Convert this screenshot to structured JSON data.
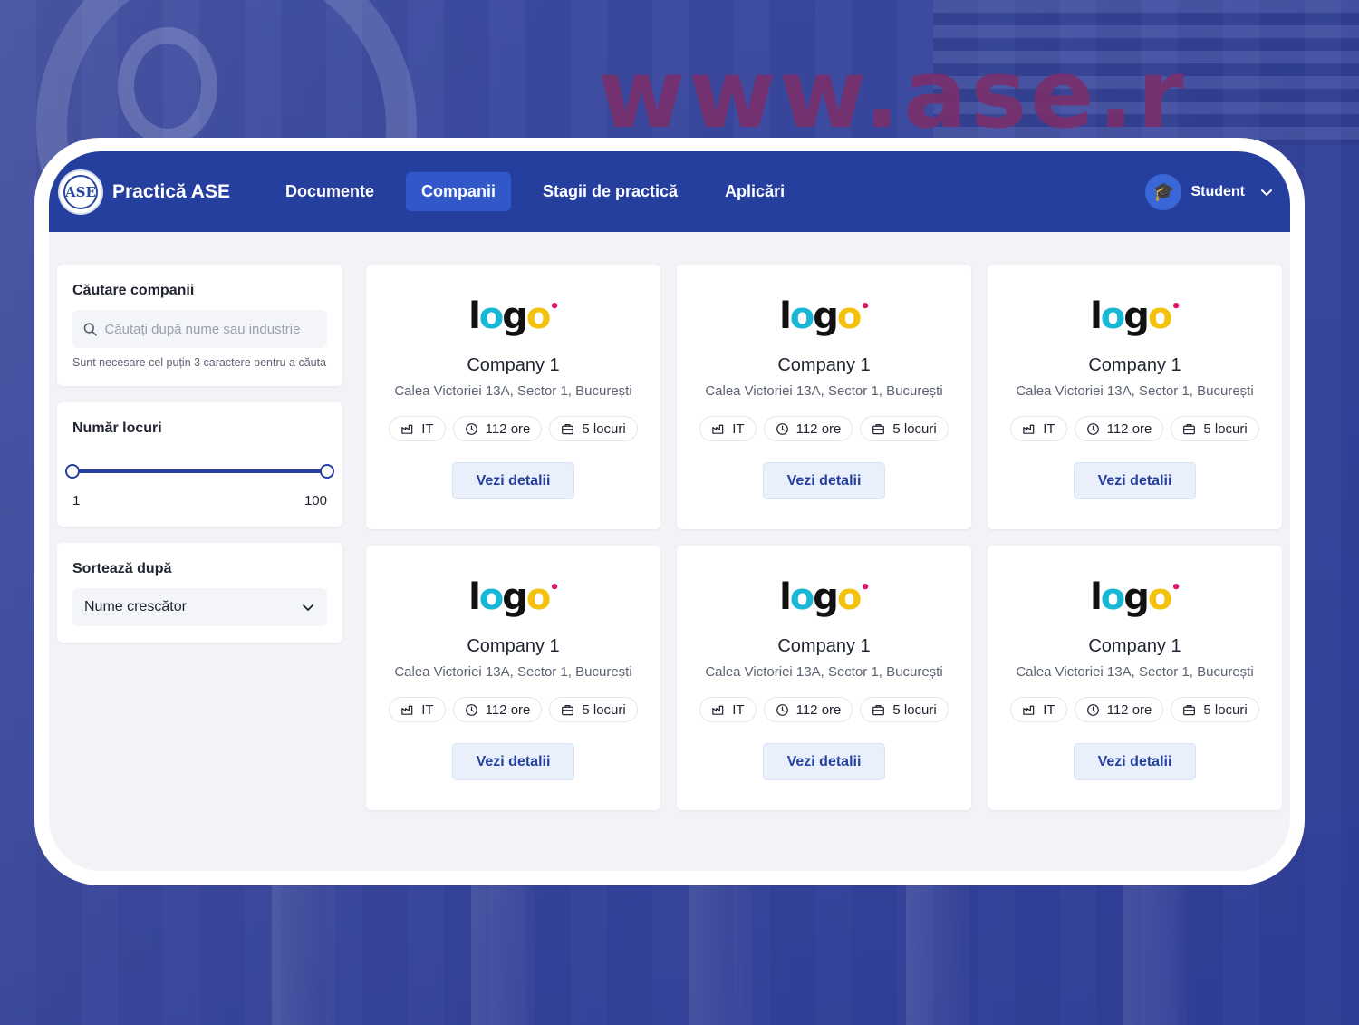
{
  "background": {
    "watermark_text": "www.ase.r"
  },
  "header": {
    "brand_logo_text": "ASE",
    "brand_name": "Practică ASE",
    "nav": [
      {
        "label": "Documente",
        "active": false
      },
      {
        "label": "Companii",
        "active": true
      },
      {
        "label": "Stagii de practică",
        "active": false
      },
      {
        "label": "Aplicări",
        "active": false
      }
    ],
    "user": {
      "name": "Student",
      "avatar_icon": "graduation-cap-icon"
    }
  },
  "filters": {
    "search": {
      "title": "Căutare companii",
      "placeholder": "Căutați după nume sau industrie",
      "value": "",
      "hint": "Sunt necesare cel puțin 3 caractere pentru a căuta"
    },
    "places": {
      "title": "Număr locuri",
      "min_label": "1",
      "max_label": "100",
      "min": 1,
      "max": 100
    },
    "sort": {
      "title": "Sortează după",
      "selected": "Nume crescător"
    }
  },
  "companies": [
    {
      "logo": "logo",
      "name": "Company 1",
      "address": "Calea Victoriei 13A, Sector 1, București",
      "industry": "IT",
      "hours": "112 ore",
      "places": "5 locuri",
      "button": "Vezi detalii"
    },
    {
      "logo": "logo",
      "name": "Company 1",
      "address": "Calea Victoriei 13A, Sector 1, București",
      "industry": "IT",
      "hours": "112 ore",
      "places": "5 locuri",
      "button": "Vezi detalii"
    },
    {
      "logo": "logo",
      "name": "Company 1",
      "address": "Calea Victoriei 13A, Sector 1, București",
      "industry": "IT",
      "hours": "112 ore",
      "places": "5 locuri",
      "button": "Vezi detalii"
    },
    {
      "logo": "logo",
      "name": "Company 1",
      "address": "Calea Victoriei 13A, Sector 1, București",
      "industry": "IT",
      "hours": "112 ore",
      "places": "5 locuri",
      "button": "Vezi detalii"
    },
    {
      "logo": "logo",
      "name": "Company 1",
      "address": "Calea Victoriei 13A, Sector 1, București",
      "industry": "IT",
      "hours": "112 ore",
      "places": "5 locuri",
      "button": "Vezi detalii"
    },
    {
      "logo": "logo",
      "name": "Company 1",
      "address": "Calea Victoriei 13A, Sector 1, București",
      "industry": "IT",
      "hours": "112 ore",
      "places": "5 locuri",
      "button": "Vezi detalii"
    }
  ],
  "colors": {
    "primary": "#253f9e",
    "nav_active": "#3157c9",
    "button_bg": "#e9f0fb",
    "logo_cyan": "#18b7d6",
    "logo_magenta": "#e0166a",
    "logo_yellow": "#f4c20d"
  }
}
